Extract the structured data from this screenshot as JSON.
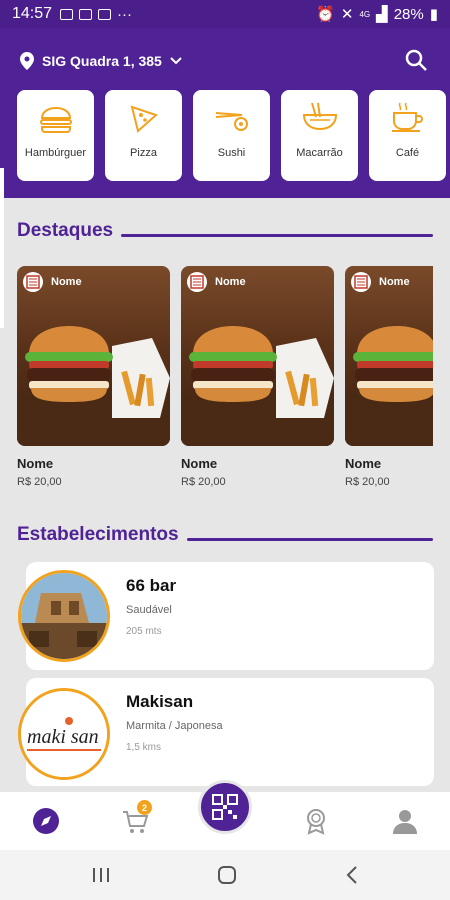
{
  "status_bar": {
    "time": "14:57",
    "signal_label": "4G",
    "battery": "28%"
  },
  "header": {
    "location": "SIG Quadra 1, 385"
  },
  "categories": [
    {
      "label": "Hambúrguer",
      "icon": "burger-icon"
    },
    {
      "label": "Pizza",
      "icon": "pizza-icon"
    },
    {
      "label": "Sushi",
      "icon": "sushi-icon"
    },
    {
      "label": "Macarrão",
      "icon": "noodles-icon"
    },
    {
      "label": "Café",
      "icon": "coffee-icon"
    }
  ],
  "highlights": {
    "title": "Destaques",
    "items": [
      {
        "badge": "Nome",
        "name": "Nome",
        "price": "R$ 20,00"
      },
      {
        "badge": "Nome",
        "name": "Nome",
        "price": "R$ 20,00"
      },
      {
        "badge": "Nome",
        "name": "Nome",
        "price": "R$ 20,00"
      }
    ]
  },
  "establishments": {
    "title": "Estabelecimentos",
    "items": [
      {
        "name": "66 bar",
        "category": "Saudável",
        "distance": "205 mts"
      },
      {
        "name": "Makisan",
        "category": "Marmita / Japonesa",
        "distance": "1,5 kms",
        "logo_text": "maki san"
      }
    ]
  },
  "bottom_nav": {
    "cart_count": "2"
  },
  "colors": {
    "primary": "#4f2396",
    "accent": "#f2a21c"
  }
}
